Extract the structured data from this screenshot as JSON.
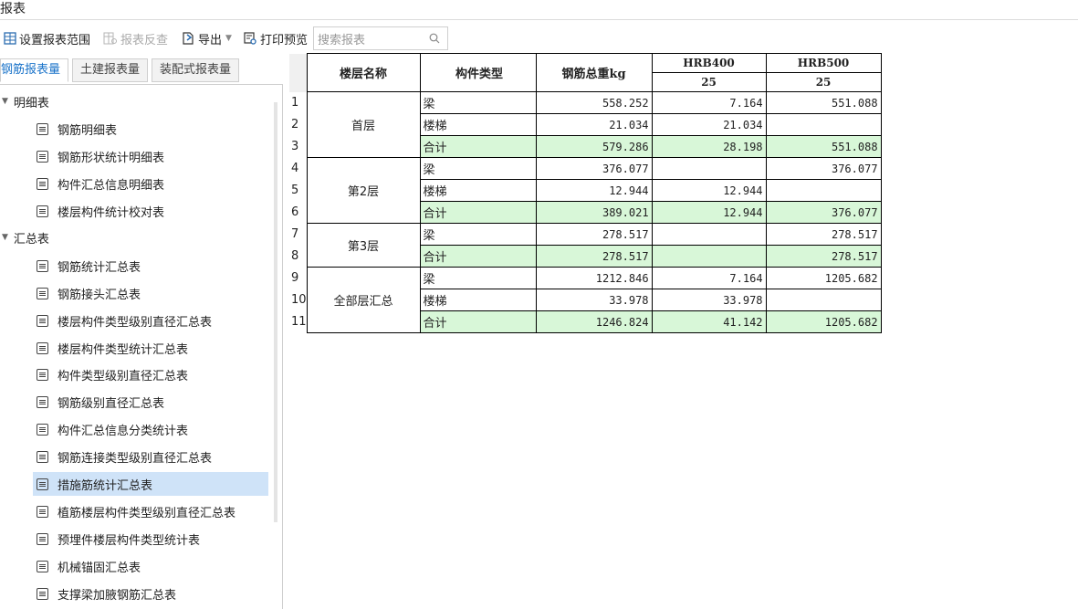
{
  "window": {
    "title": "报表"
  },
  "toolbar": {
    "set_range": "设置报表范围",
    "reverse_check": "报表反查",
    "export": "导出",
    "print_preview": "打印预览",
    "search_placeholder": "搜索报表"
  },
  "tabs": [
    "钢筋报表量",
    "土建报表量",
    "装配式报表量"
  ],
  "tree": {
    "groups": [
      {
        "label": "明细表",
        "items": [
          "钢筋明细表",
          "钢筋形状统计明细表",
          "构件汇总信息明细表",
          "楼层构件统计校对表"
        ]
      },
      {
        "label": "汇总表",
        "items": [
          "钢筋统计汇总表",
          "钢筋接头汇总表",
          "楼层构件类型级别直径汇总表",
          "楼层构件类型统计汇总表",
          "构件类型级别直径汇总表",
          "钢筋级别直径汇总表",
          "构件汇总信息分类统计表",
          "钢筋连接类型级别直径汇总表",
          "措施筋统计汇总表",
          "植筋楼层构件类型级别直径汇总表",
          "预埋件楼层构件类型统计表",
          "机械锚固汇总表",
          "支撑梁加腋钢筋汇总表"
        ]
      }
    ],
    "selected": "措施筋统计汇总表"
  },
  "table": {
    "headers": {
      "floor": "楼层名称",
      "type": "构件类型",
      "total": "钢筋总重kg",
      "hrb400": "HRB400",
      "hrb500": "HRB500",
      "d400": "25",
      "d500": "25"
    },
    "row_numbers": [
      "1",
      "2",
      "3",
      "4",
      "5",
      "6",
      "7",
      "8",
      "9",
      "10",
      "11"
    ],
    "floors": [
      "首层",
      "第2层",
      "第3层",
      "全部层汇总"
    ],
    "rows": [
      {
        "type": "梁",
        "total": "558.252",
        "h4": "7.164",
        "h5": "551.088"
      },
      {
        "type": "楼梯",
        "total": "21.034",
        "h4": "21.034",
        "h5": ""
      },
      {
        "type": "合计",
        "total": "579.286",
        "h4": "28.198",
        "h5": "551.088"
      },
      {
        "type": "梁",
        "total": "376.077",
        "h4": "",
        "h5": "376.077"
      },
      {
        "type": "楼梯",
        "total": "12.944",
        "h4": "12.944",
        "h5": ""
      },
      {
        "type": "合计",
        "total": "389.021",
        "h4": "12.944",
        "h5": "376.077"
      },
      {
        "type": "梁",
        "total": "278.517",
        "h4": "",
        "h5": "278.517"
      },
      {
        "type": "合计",
        "total": "278.517",
        "h4": "",
        "h5": "278.517"
      },
      {
        "type": "梁",
        "total": "1212.846",
        "h4": "7.164",
        "h5": "1205.682"
      },
      {
        "type": "楼梯",
        "total": "33.978",
        "h4": "33.978",
        "h5": ""
      },
      {
        "type": "合计",
        "total": "1246.824",
        "h4": "41.142",
        "h5": "1205.682"
      }
    ]
  }
}
